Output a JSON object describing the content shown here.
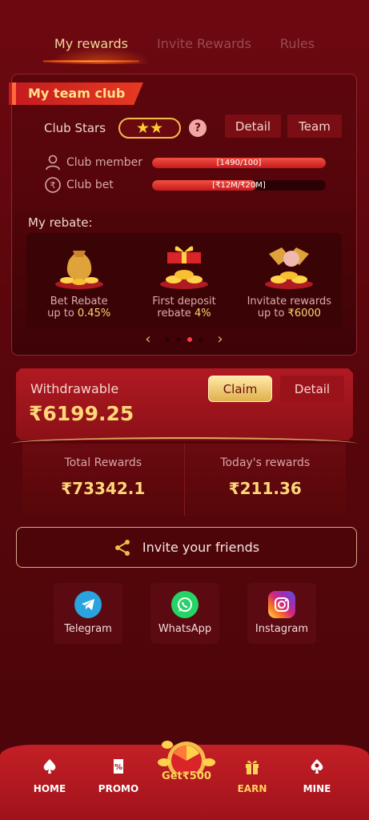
{
  "tabs": [
    {
      "label": "My rewards",
      "active": true
    },
    {
      "label": "Invite Rewards",
      "active": false
    },
    {
      "label": "Rules",
      "active": false
    }
  ],
  "club": {
    "title": "My team club",
    "stars_label": "Club Stars",
    "stars": 2,
    "stars_glyph": "★★",
    "help_icon": "question-icon",
    "detail_label": "Detail",
    "team_label": "Team",
    "member": {
      "label": "Club member",
      "progress_text": "[1490/100]",
      "progress": 1.0
    },
    "bet": {
      "label": "Club bet",
      "progress_text": "[₹12M/₹20M]",
      "progress": 0.6
    }
  },
  "rebate": {
    "title": "My rebate:",
    "items": [
      {
        "line1": "Bet Rebate",
        "line2_prefix": "up to ",
        "line2_value": "0.45%"
      },
      {
        "line1": "First deposit",
        "line2_prefix": "rebate ",
        "line2_value": "4%"
      },
      {
        "line1": "Invitate rewards",
        "line2_prefix": "up to ",
        "line2_value": "₹6000"
      }
    ],
    "pager": {
      "prev": "‹",
      "next": "›",
      "active_index": 2
    }
  },
  "withdraw": {
    "label": "Withdrawable",
    "amount": "₹6199.25",
    "claim_label": "Claim",
    "detail_label": "Detail"
  },
  "rewards": {
    "total_label": "Total Rewards",
    "total_value": "₹73342.1",
    "today_label": "Today's rewards",
    "today_value": "₹211.36"
  },
  "invite": {
    "label": "Invite your friends"
  },
  "share": [
    {
      "label": "Telegram",
      "icon": "telegram-icon",
      "color": "#2aa3df"
    },
    {
      "label": "WhatsApp",
      "icon": "whatsapp-icon",
      "color": "#25d366"
    },
    {
      "label": "Instagram",
      "icon": "instagram-icon",
      "color": "#d62976"
    }
  ],
  "nav": {
    "home": "HOME",
    "promo": "PROMO",
    "center": "Get₹500",
    "earn": "EARN",
    "mine": "MINE"
  },
  "colors": {
    "accent_gold": "#ffd77a",
    "brand_red": "#c41f26",
    "bg": "#5a060c"
  }
}
